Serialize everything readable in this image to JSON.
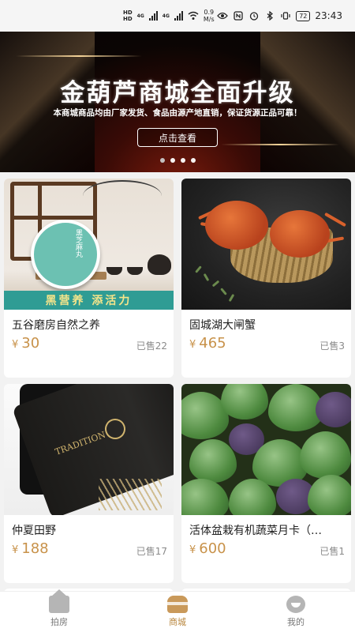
{
  "status_bar": {
    "hd_top": "HD",
    "hd_bottom": "HD",
    "network_1": "4G",
    "network_2": "4G",
    "speed_value": "0.9",
    "speed_unit": "M/s",
    "battery": "72",
    "time": "23:43"
  },
  "banner": {
    "title": "金葫芦商城全面升级",
    "subtitle": "本商城商品均由厂家发货、食品由源产地直销，保证货源正品可靠！",
    "button_label": "点击查看",
    "slide_count": 4,
    "active_slide_index": 0
  },
  "products": [
    {
      "name": "五谷磨房自然之养",
      "currency": "¥",
      "price": "30",
      "sold": "已售22",
      "image_caption": "黑芝麻丸",
      "image_banner": "黑营养 添活力"
    },
    {
      "name": "固城湖大闸蟹",
      "currency": "¥",
      "price": "465",
      "sold": "已售3"
    },
    {
      "name": "仲夏田野",
      "currency": "¥",
      "price": "188",
      "sold": "已售17",
      "image_caption": "TRADITION"
    },
    {
      "name": "活体盆栽有机蔬菜月卡（…",
      "currency": "¥",
      "price": "600",
      "sold": "已售1"
    }
  ],
  "tabbar": {
    "tabs": [
      {
        "label": "拍房",
        "icon": "house-icon",
        "active": false
      },
      {
        "label": "商城",
        "icon": "shop-icon",
        "active": true
      },
      {
        "label": "我的",
        "icon": "profile-icon",
        "active": false
      }
    ],
    "active_color": "#b8863d",
    "inactive_color": "#777777"
  },
  "colors": {
    "price": "#c8924a",
    "sold": "#8a8a8a",
    "background": "#f2f2f2"
  }
}
